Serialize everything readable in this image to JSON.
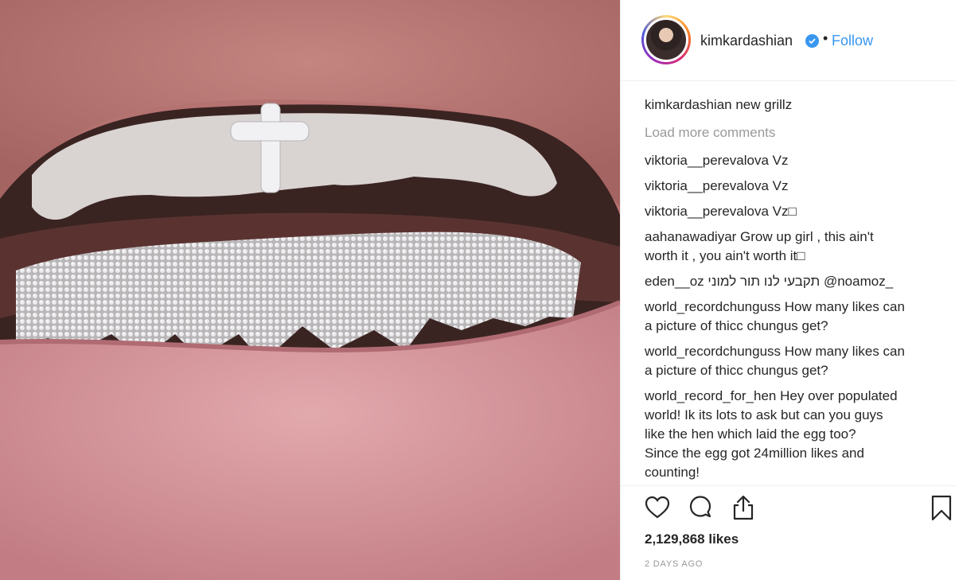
{
  "post": {
    "image_alt": "Close-up of lips with diamond grillz",
    "author": "kimkardashian",
    "follow_label": "Follow",
    "separator": "•"
  },
  "comments": {
    "caption": {
      "user": "kimkardashian",
      "text": "new grillz"
    },
    "load_more_label": "Load more comments",
    "items": [
      {
        "user": "viktoria__perevalova",
        "text": "Vz"
      },
      {
        "user": "viktoria__perevalova",
        "text": "Vz"
      },
      {
        "user": "viktoria__perevalova",
        "text": "Vz□"
      },
      {
        "user": "aahanawadiyar",
        "text": "Grow up girl , this ain't",
        "text2": "worth it , you ain't worth it□"
      },
      {
        "user": "eden__oz",
        "text": "תקבעי לנו תור למוני @noamoz_"
      },
      {
        "user": "world_recordchunguss",
        "text": "How many likes can",
        "text2": "a picture of thicc chungus get?"
      },
      {
        "user": "world_recordchunguss",
        "text": "How many likes can",
        "text2": "a picture of thicc chungus get?"
      },
      {
        "user": "world_record_for_hen",
        "text": "Hey over populated",
        "text2": "world! Ik its lots to ask but can you guys",
        "text3": "like the hen which laid the egg too?",
        "text4": "Since the egg got 24million likes and",
        "text5": "counting!"
      }
    ]
  },
  "actions": {
    "like_icon": "heart-icon",
    "comment_icon": "comment-icon",
    "share_icon": "share-icon",
    "save_icon": "bookmark-icon"
  },
  "likes_label": "2,129,868 likes",
  "timestamp": "2 DAYS AGO",
  "colors": {
    "link": "#3897f0",
    "muted": "#999999",
    "text": "#262626",
    "divider": "#efefef"
  }
}
